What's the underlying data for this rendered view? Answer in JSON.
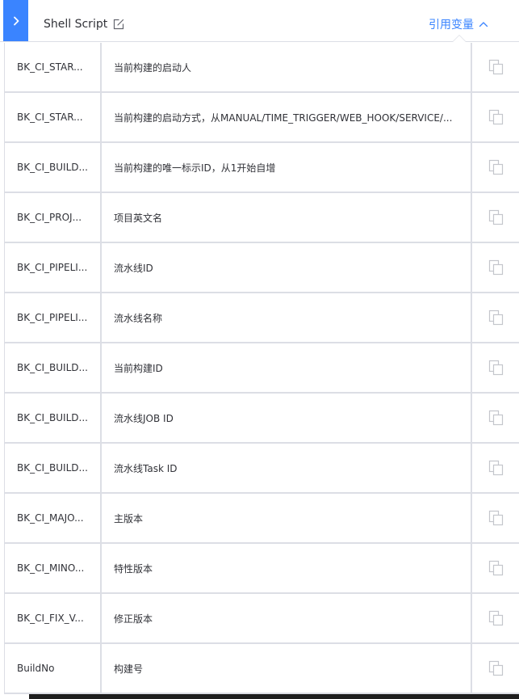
{
  "header": {
    "title": "Shell Script",
    "ref_link": "引用变量",
    "toggle_icon": "chevron-right-icon",
    "edit_icon": "edit-icon",
    "ref_chevron_icon": "chevron-up-icon",
    "accent_color": "#3a84ff"
  },
  "variables": [
    {
      "name": "BK_CI_START_USER_NAME",
      "display_name": "BK_CI_STAR...",
      "desc": "当前构建的启动人"
    },
    {
      "name": "BK_CI_START_TYPE",
      "display_name": "BK_CI_STAR...",
      "desc": "当前构建的启动方式，从MANUAL/TIME_TRIGGER/WEB_HOOK/SERVICE/..."
    },
    {
      "name": "BK_CI_BUILD_NUM",
      "display_name": "BK_CI_BUILD...",
      "desc": "当前构建的唯一标示ID，从1开始自增"
    },
    {
      "name": "BK_CI_PROJECT_NAME",
      "display_name": "BK_CI_PROJ...",
      "desc": "项目英文名"
    },
    {
      "name": "BK_CI_PIPELINE_ID",
      "display_name": "BK_CI_PIPELI...",
      "desc": "流水线ID"
    },
    {
      "name": "BK_CI_PIPELINE_NAME",
      "display_name": "BK_CI_PIPELI...",
      "desc": "流水线名称"
    },
    {
      "name": "BK_CI_BUILD_ID",
      "display_name": "BK_CI_BUILD...",
      "desc": "当前构建ID"
    },
    {
      "name": "BK_CI_BUILD_JOB_ID",
      "display_name": "BK_CI_BUILD...",
      "desc": "流水线JOB ID"
    },
    {
      "name": "BK_CI_BUILD_TASK_ID",
      "display_name": "BK_CI_BUILD...",
      "desc": "流水线Task ID"
    },
    {
      "name": "BK_CI_MAJOR_VERSION",
      "display_name": "BK_CI_MAJO...",
      "desc": "主版本"
    },
    {
      "name": "BK_CI_MINOR_VERSION",
      "display_name": "BK_CI_MINO...",
      "desc": "特性版本"
    },
    {
      "name": "BK_CI_FIX_VERSION",
      "display_name": "BK_CI_FIX_V...",
      "desc": "修正版本"
    },
    {
      "name": "BuildNo",
      "display_name": "BuildNo",
      "desc": "构建号"
    }
  ]
}
